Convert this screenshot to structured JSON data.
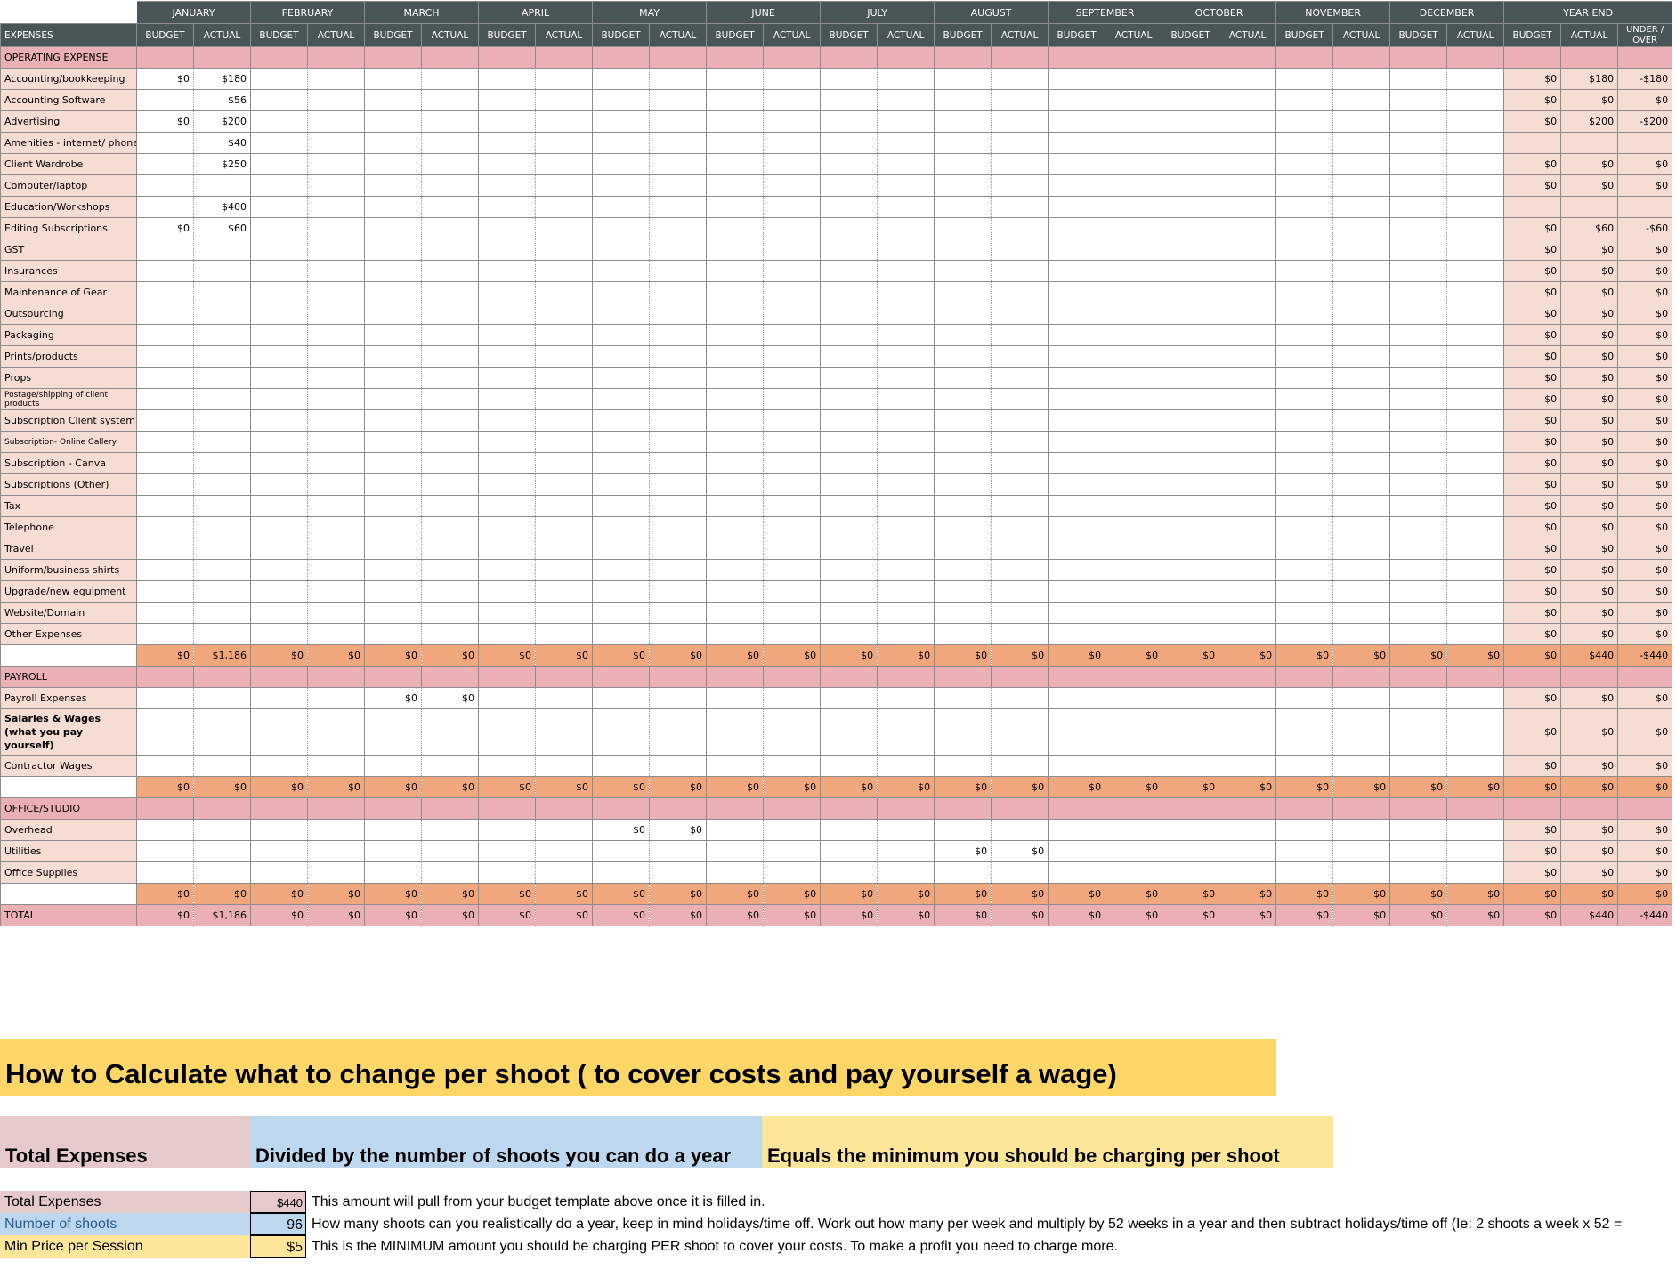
{
  "sheet": {
    "months": [
      "JANUARY",
      "FEBRUARY",
      "MARCH",
      "APRIL",
      "MAY",
      "JUNE",
      "JULY",
      "AUGUST",
      "SEPTEMBER",
      "OCTOBER",
      "NOVEMBER",
      "DECEMBER",
      "YEAR END"
    ],
    "expenses_header": "EXPENSES",
    "budget_label": "BUDGET",
    "actual_label": "ACTUAL",
    "under_over_label": "UNDER / OVER",
    "sections": [
      {
        "title": "OPERATING EXPENSE",
        "rows": [
          {
            "label": "Accounting/bookkeeping",
            "cells": {
              "0": [
                "$0",
                "$180"
              ]
            },
            "ye": [
              "$0",
              "$180",
              "-$180"
            ]
          },
          {
            "label": "Accounting Software",
            "cells": {
              "0": [
                "",
                "$56"
              ]
            },
            "ye": [
              "$0",
              "$0",
              "$0"
            ]
          },
          {
            "label": "Advertising",
            "cells": {
              "0": [
                "$0",
                "$200"
              ]
            },
            "ye": [
              "$0",
              "$200",
              "-$200"
            ]
          },
          {
            "label": "Amenities - internet/ phone",
            "cells": {
              "0": [
                "",
                "$40"
              ]
            },
            "ye": [
              "",
              "",
              ""
            ]
          },
          {
            "label": "Client Wardrobe",
            "cells": {
              "0": [
                "",
                "$250"
              ]
            },
            "ye": [
              "$0",
              "$0",
              "$0"
            ]
          },
          {
            "label": "Computer/laptop",
            "cells": {},
            "ye": [
              "$0",
              "$0",
              "$0"
            ]
          },
          {
            "label": "Education/Workshops",
            "cells": {
              "0": [
                "",
                "$400"
              ]
            },
            "ye": [
              "",
              "",
              ""
            ]
          },
          {
            "label": "Editing Subscriptions",
            "cells": {
              "0": [
                "$0",
                "$60"
              ]
            },
            "ye": [
              "$0",
              "$60",
              "-$60"
            ]
          },
          {
            "label": "GST",
            "cells": {},
            "ye": [
              "$0",
              "$0",
              "$0"
            ]
          },
          {
            "label": "Insurances",
            "cells": {},
            "ye": [
              "$0",
              "$0",
              "$0"
            ]
          },
          {
            "label": "Maintenance of Gear",
            "cells": {},
            "ye": [
              "$0",
              "$0",
              "$0"
            ]
          },
          {
            "label": "Outsourcing",
            "cells": {},
            "ye": [
              "$0",
              "$0",
              "$0"
            ]
          },
          {
            "label": "Packaging",
            "cells": {},
            "ye": [
              "$0",
              "$0",
              "$0"
            ]
          },
          {
            "label": "Prints/products",
            "cells": {},
            "ye": [
              "$0",
              "$0",
              "$0"
            ]
          },
          {
            "label": "Props",
            "cells": {},
            "ye": [
              "$0",
              "$0",
              "$0"
            ]
          },
          {
            "label": "Postage/shipping of client products",
            "small": true,
            "cells": {},
            "ye": [
              "$0",
              "$0",
              "$0"
            ]
          },
          {
            "label": "Subscription Client system",
            "cells": {},
            "ye": [
              "$0",
              "$0",
              "$0"
            ]
          },
          {
            "label": " Subscription- Online Gallery",
            "small": true,
            "cells": {},
            "ye": [
              "$0",
              "$0",
              "$0"
            ]
          },
          {
            "label": "Subscription - Canva",
            "cells": {},
            "ye": [
              "$0",
              "$0",
              "$0"
            ]
          },
          {
            "label": "Subscriptions (Other)",
            "cells": {},
            "ye": [
              "$0",
              "$0",
              "$0"
            ]
          },
          {
            "label": "Tax",
            "cells": {},
            "ye": [
              "$0",
              "$0",
              "$0"
            ]
          },
          {
            "label": "Telephone",
            "cells": {},
            "ye": [
              "$0",
              "$0",
              "$0"
            ]
          },
          {
            "label": "Travel",
            "cells": {},
            "ye": [
              "$0",
              "$0",
              "$0"
            ]
          },
          {
            "label": "Uniform/business shirts",
            "cells": {},
            "ye": [
              "$0",
              "$0",
              "$0"
            ]
          },
          {
            "label": "Upgrade/new equipment",
            "cells": {},
            "ye": [
              "$0",
              "$0",
              "$0"
            ]
          },
          {
            "label": "Website/Domain",
            "cells": {},
            "ye": [
              "$0",
              "$0",
              "$0"
            ]
          },
          {
            "label": "Other Expenses",
            "cells": {},
            "ye": [
              "$0",
              "$0",
              "$0"
            ]
          }
        ],
        "subtotal": {
          "jan_actual": "$1,186",
          "ye": [
            "$0",
            "$440",
            "-$440"
          ]
        }
      },
      {
        "title": "PAYROLL",
        "rows": [
          {
            "label": "Payroll Expenses",
            "cells": {
              "2": [
                "$0",
                "$0"
              ]
            },
            "ye": [
              "$0",
              "$0",
              "$0"
            ]
          },
          {
            "label": "Salaries & Wages (what you pay yourself)",
            "bold": true,
            "tall": true,
            "cells": {},
            "ye": [
              "$0",
              "$0",
              "$0"
            ]
          },
          {
            "label": "Contractor Wages",
            "cells": {},
            "ye": [
              "$0",
              "$0",
              "$0"
            ]
          }
        ],
        "subtotal": {
          "jan_actual": "$0",
          "ye": [
            "$0",
            "$0",
            "$0"
          ]
        }
      },
      {
        "title": "OFFICE/STUDIO",
        "rows": [
          {
            "label": "Overhead",
            "cells": {
              "4": [
                "$0",
                "$0"
              ]
            },
            "ye": [
              "$0",
              "$0",
              "$0"
            ]
          },
          {
            "label": "Utilities",
            "cells": {
              "7": [
                "$0",
                "$0"
              ]
            },
            "ye": [
              "$0",
              "$0",
              "$0"
            ]
          },
          {
            "label": "Office Supplies",
            "cells": {},
            "ye": [
              "$0",
              "$0",
              "$0"
            ]
          }
        ],
        "subtotal": {
          "jan_actual": "$0",
          "ye": [
            "$0",
            "$0",
            "$0"
          ]
        }
      }
    ],
    "total": {
      "label": "TOTAL",
      "jan_actual": "$1,186",
      "ye": [
        "$0",
        "$440",
        "-$440"
      ]
    },
    "zero": "$0"
  },
  "howto": {
    "title": "How to Calculate what to change per shoot ( to cover costs and pay yourself a wage)",
    "step1": "Total Expenses",
    "step2": "Divided by the number of shoots you can do a year",
    "step3": "Equals the minimum you should be charging per shoot",
    "rows": [
      {
        "label": "Total Expenses",
        "value": "$440",
        "note": "This amount will pull from your budget template above once it is filled in."
      },
      {
        "label": "Number of shoots",
        "value": "96",
        "note": "How many shoots can you realistically do a year, keep in mind holidays/time off. Work out how many per week and multiply by 52 weeks in a year and then subtract holidays/time off    (Ie: 2 shoots a week x 52 ="
      },
      {
        "label": "Min Price per Session",
        "value": "$5",
        "note": "This is the MINIMUM amount you should be charging PER shoot to cover your costs. To make a profit you need to charge more."
      }
    ]
  }
}
